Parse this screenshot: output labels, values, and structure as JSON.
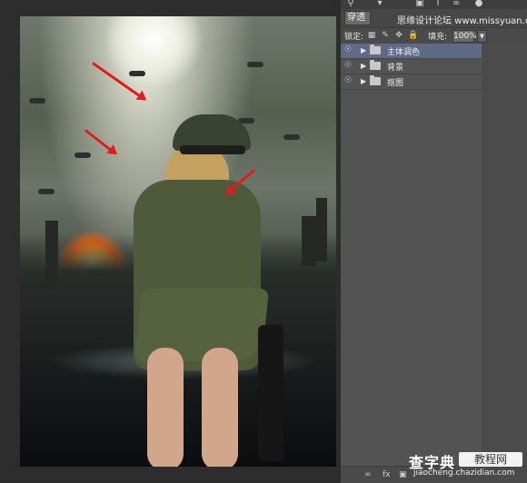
{
  "panel": {
    "watermark": "思缘设计论坛 www.missyuan.com",
    "blend_label": "穿透",
    "lock_label": "锁定:",
    "fill_label": "填充:",
    "fill_value": "100%",
    "layers": [
      {
        "name": "主体调色",
        "selected": true
      },
      {
        "name": "背景",
        "selected": false
      },
      {
        "name": "抠图",
        "selected": false
      }
    ],
    "top_icons": [
      "search-icon",
      "dropdown-icon",
      "lock-icon",
      "type-icon",
      "link-icon",
      "filter-icon"
    ],
    "bottom_icons": [
      "link-icon",
      "fx-icon",
      "mask-icon"
    ]
  },
  "badge": {
    "site_name": "查字典",
    "site_tag": "教程网",
    "site_url": "jiaocheng.chazidian.com"
  },
  "colors": {
    "selected_layer": "#5e6a86",
    "arrow": "#e21b1b",
    "panel_bg": "#535353"
  }
}
